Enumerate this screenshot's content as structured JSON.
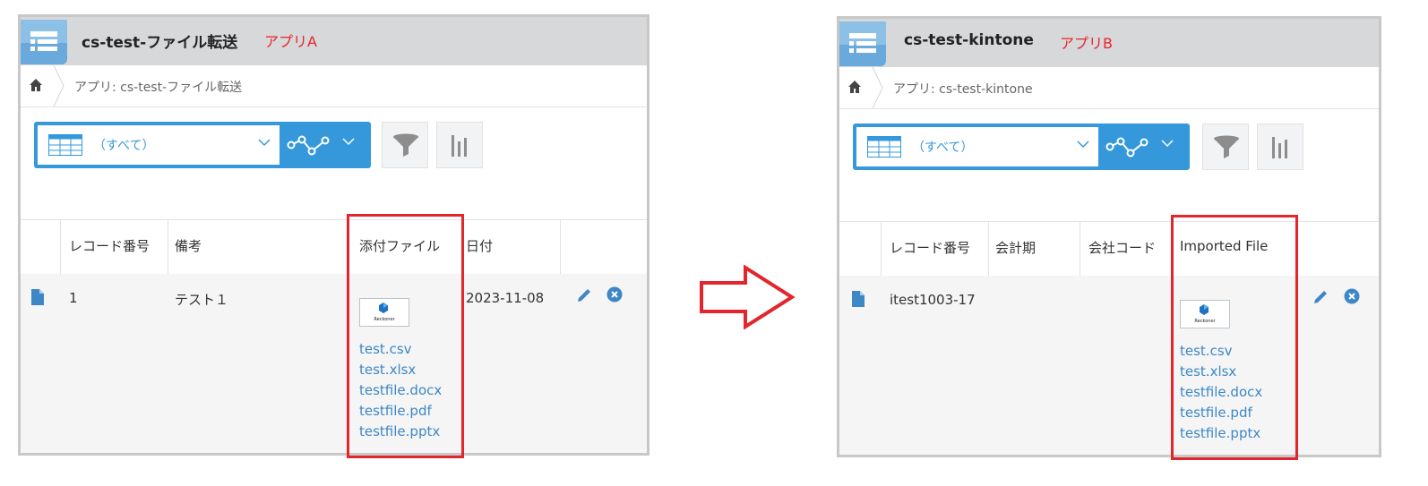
{
  "icons": {
    "app": "list-icon",
    "home": "home-icon",
    "view": "table-grid-icon",
    "graph": "line-graph-icon",
    "filter": "funnel-icon",
    "chart": "bar-chart-icon",
    "record": "document-icon",
    "edit": "pencil-icon",
    "delete": "close-circle-icon",
    "arrow": "right-arrow-icon"
  },
  "colors": {
    "accent": "#3498db",
    "link": "#3d87c6",
    "highlight": "#e3262d",
    "header_bg": "#d6d8d9"
  },
  "app_a": {
    "title": "cs-test-ファイル転送",
    "label": "アプリA",
    "breadcrumb": "アプリ: cs-test-ファイル転送",
    "view_name": "（すべて）",
    "columns": [
      "レコード番号",
      "備考",
      "添付ファイル",
      "日付"
    ],
    "record": {
      "number": "1",
      "note": "テスト１",
      "date": "2023-11-08",
      "thumbnail_label": "Reckoner",
      "files": [
        "test.csv",
        "test.xlsx",
        "testfile.docx",
        "testfile.pdf",
        "testfile.pptx"
      ]
    }
  },
  "app_b": {
    "title": "cs-test-kintone",
    "label": "アプリB",
    "breadcrumb": "アプリ: cs-test-kintone",
    "view_name": "（すべて）",
    "columns": [
      "レコード番号",
      "会計期",
      "会社コード",
      "Imported File"
    ],
    "record": {
      "number": "itest1003-17",
      "fiscal_period": "",
      "company_code": "",
      "thumbnail_label": "Reckoner",
      "files": [
        "test.csv",
        "test.xlsx",
        "testfile.docx",
        "testfile.pdf",
        "testfile.pptx"
      ]
    }
  }
}
